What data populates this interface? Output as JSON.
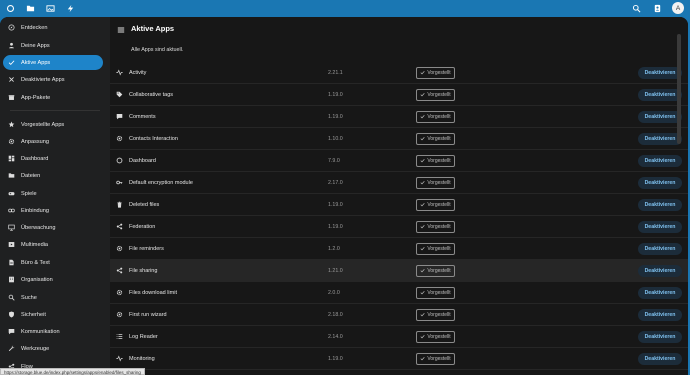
{
  "topbar": {
    "icons": [
      "nextcloud-logo-icon",
      "files-icon",
      "photos-icon",
      "activity-icon"
    ],
    "right_icons": [
      "search-icon",
      "contacts-icon"
    ],
    "avatar_letter": "A"
  },
  "sidebar": {
    "items": [
      {
        "label": "Entdecken",
        "icon": "compass-icon"
      },
      {
        "label": "Deine Apps",
        "icon": "user-icon"
      },
      {
        "label": "Aktive Apps",
        "icon": "check-icon",
        "active": true
      },
      {
        "label": "Deaktivierte Apps",
        "icon": "close-icon"
      },
      {
        "label": "App-Pakete",
        "icon": "package-icon"
      },
      {
        "label": "Vorgestellte Apps",
        "icon": "star-icon"
      },
      {
        "label": "Anpassung",
        "icon": "settings-icon"
      },
      {
        "label": "Dashboard",
        "icon": "dashboard-icon"
      },
      {
        "label": "Dateien",
        "icon": "folder-icon"
      },
      {
        "label": "Spiele",
        "icon": "gamepad-icon"
      },
      {
        "label": "Einbindung",
        "icon": "link-icon"
      },
      {
        "label": "Überwachung",
        "icon": "monitor-icon"
      },
      {
        "label": "Multimedia",
        "icon": "multimedia-icon"
      },
      {
        "label": "Büro & Text",
        "icon": "document-icon"
      },
      {
        "label": "Organisation",
        "icon": "organisation-icon"
      },
      {
        "label": "Suche",
        "icon": "search-icon"
      },
      {
        "label": "Sicherheit",
        "icon": "shield-icon"
      },
      {
        "label": "Kommunikation",
        "icon": "chat-icon"
      },
      {
        "label": "Werkzeuge",
        "icon": "tools-icon"
      },
      {
        "label": "Flow",
        "icon": "flow-icon"
      }
    ]
  },
  "main": {
    "title": "Aktive Apps",
    "up_to_date": "Alle Apps sind aktuell.",
    "preset_label": "Vorgestellt",
    "deactivate_label": "Deaktivieren",
    "apps": [
      {
        "name": "Activity",
        "version": "2.21.1",
        "icon": "activity-icon"
      },
      {
        "name": "Collaborative tags",
        "version": "1.19.0",
        "icon": "tag-icon"
      },
      {
        "name": "Comments",
        "version": "1.19.0",
        "icon": "comment-icon"
      },
      {
        "name": "Contacts Interaction",
        "version": "1.10.0",
        "icon": "settings-icon"
      },
      {
        "name": "Dashboard",
        "version": "7.9.0",
        "icon": "circle-icon"
      },
      {
        "name": "Default encryption module",
        "version": "2.17.0",
        "icon": "key-icon"
      },
      {
        "name": "Deleted files",
        "version": "1.19.0",
        "icon": "trash-icon"
      },
      {
        "name": "Federation",
        "version": "1.19.0",
        "icon": "share-icon"
      },
      {
        "name": "File reminders",
        "version": "1.2.0",
        "icon": "settings-icon"
      },
      {
        "name": "File sharing",
        "version": "1.21.0",
        "icon": "share-icon",
        "highlighted": true
      },
      {
        "name": "Files download limit",
        "version": "2.0.0",
        "icon": "settings-icon"
      },
      {
        "name": "First run wizard",
        "version": "2.18.0",
        "icon": "settings-icon"
      },
      {
        "name": "Log Reader",
        "version": "2.14.0",
        "icon": "list-icon"
      },
      {
        "name": "Monitoring",
        "version": "1.19.0",
        "icon": "pulse-icon"
      }
    ]
  },
  "statusbar": {
    "url": "https://storage.blue.de/index.php/settings/apps/enabled/files_sharing"
  }
}
